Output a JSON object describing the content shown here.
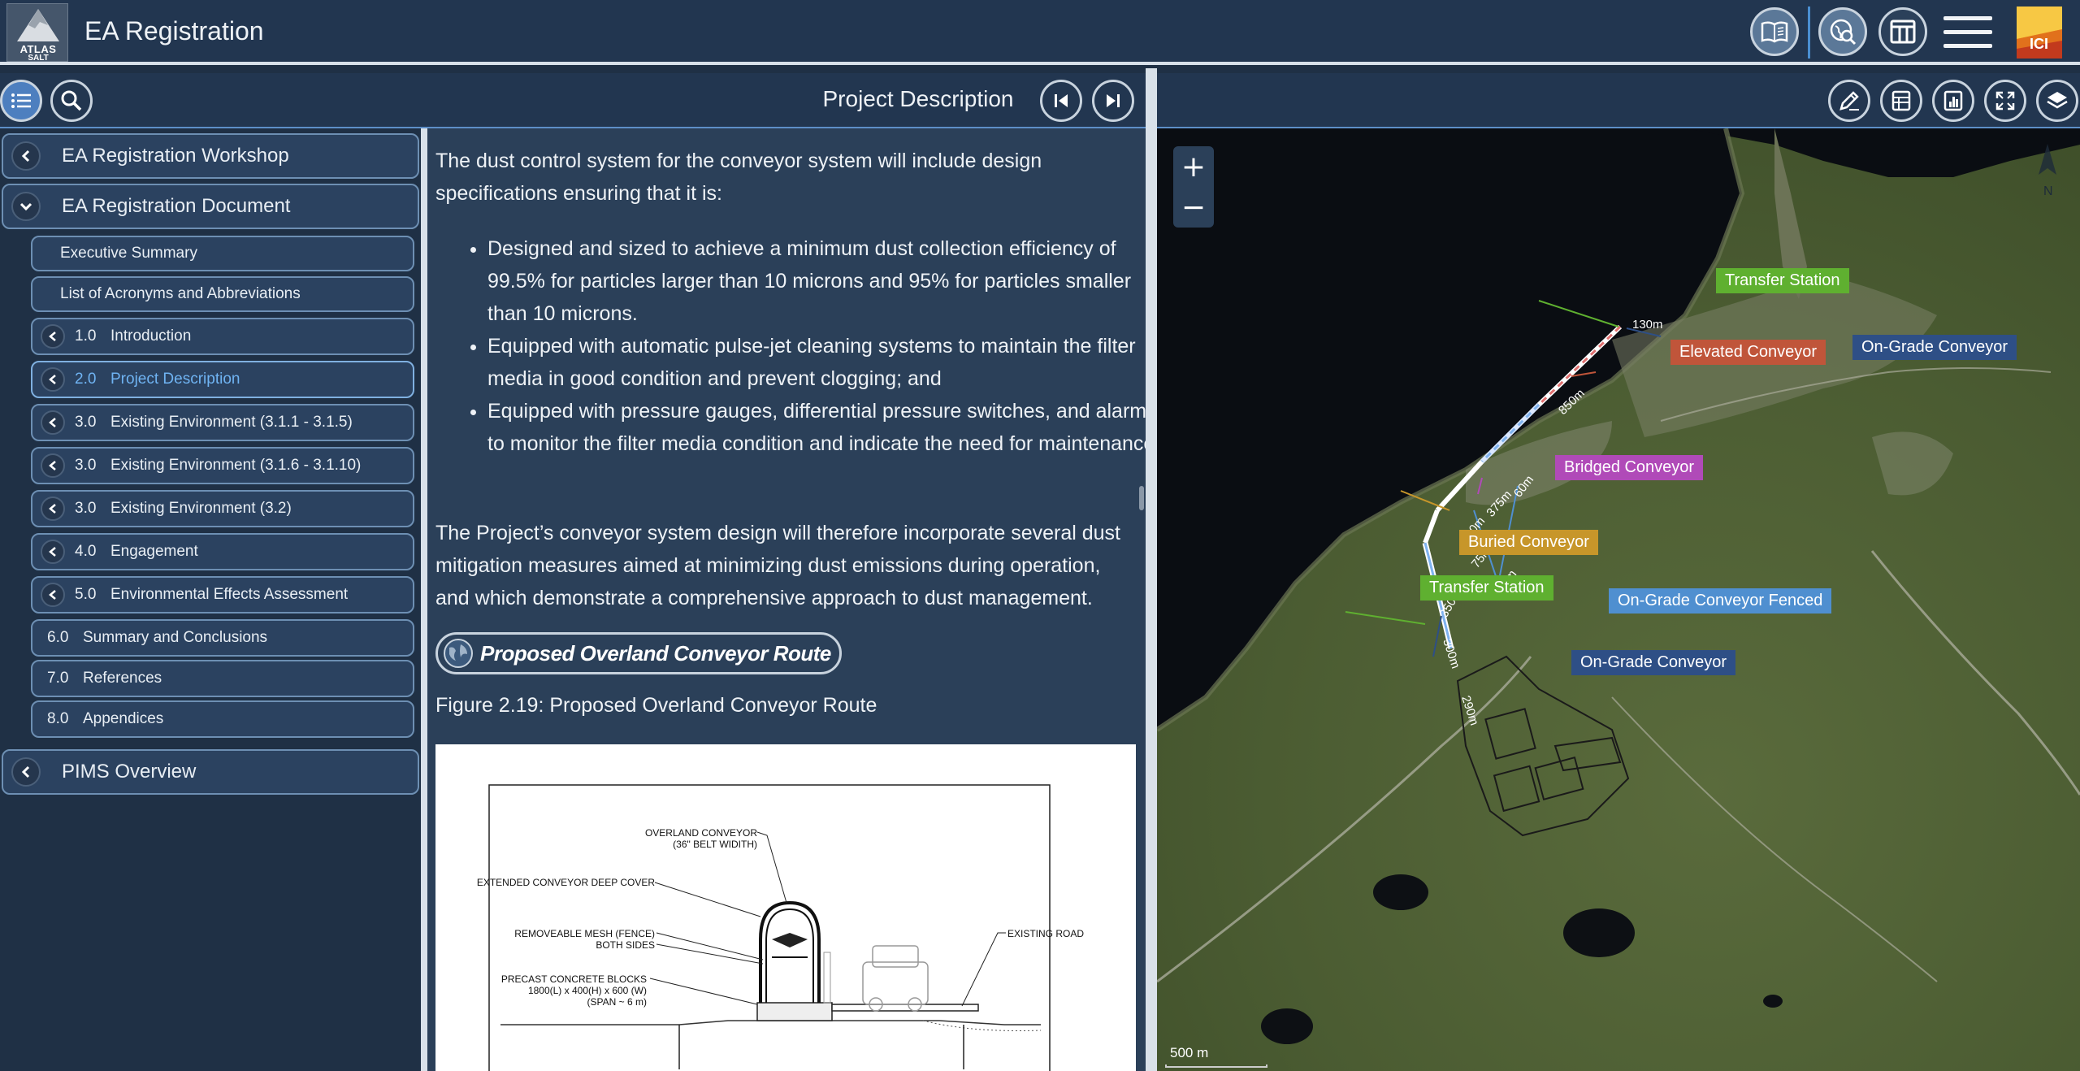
{
  "header": {
    "logo_text": "ATLAS",
    "logo_subtext": "SALT",
    "app_title": "EA Registration",
    "ici_text": "ICI",
    "buttons": [
      "book-icon",
      "globe-search-icon",
      "table-layout-icon",
      "hamburger-menu-icon"
    ]
  },
  "left_toolbar": {
    "title": "Project Description"
  },
  "sidebar": {
    "top_items": [
      {
        "label": "EA Registration Workshop"
      },
      {
        "label": "EA Registration Document"
      },
      {
        "label": "PIMS Overview"
      }
    ],
    "sub_items": [
      {
        "label": "Executive Summary"
      },
      {
        "label": "List of Acronyms and Abbreviations"
      }
    ],
    "sections": [
      {
        "num": "1.0",
        "label": "Introduction"
      },
      {
        "num": "2.0",
        "label": "Project Description"
      },
      {
        "num": "3.0",
        "label": "Existing Environment (3.1.1 - 3.1.5)"
      },
      {
        "num": "3.0",
        "label": "Existing Environment (3.1.6 - 3.1.10)"
      },
      {
        "num": "3.0",
        "label": "Existing Environment (3.2)"
      },
      {
        "num": "4.0",
        "label": "Engagement"
      },
      {
        "num": "5.0",
        "label": "Environmental Effects Assessment"
      },
      {
        "num": "6.0",
        "label": "Summary and Conclusions"
      },
      {
        "num": "7.0",
        "label": "References"
      },
      {
        "num": "8.0",
        "label": "Appendices"
      }
    ]
  },
  "content": {
    "intro": "The dust control system for the conveyor system will include design specifications ensuring that it is:",
    "bullets": [
      "Designed and sized to achieve a minimum dust collection efficiency of 99.5% for particles larger than 10 microns and 95% for particles smaller than 10 microns.",
      "Equipped with automatic pulse-jet cleaning systems to maintain the filter media in good condition and prevent clogging; and",
      "Equipped with pressure gauges, differential pressure switches, and alarms to monitor the filter media condition and indicate the need for maintenance."
    ],
    "summary": "The Project’s conveyor system design will therefore incorporate several dust mitigation measures aimed at minimizing dust emissions during operation, and which demonstrate a comprehensive approach to dust management.",
    "route_button": "Proposed Overland Conveyor Route",
    "figure_caption": "Figure 2.19: Proposed Overland Conveyor Route",
    "figure_labels": {
      "overland": "OVERLAND CONVEYOR",
      "belt": "(36\" BELT WIDITH)",
      "deep_cover": "EXTENDED CONVEYOR DEEP COVER",
      "mesh": "REMOVEABLE MESH (FENCE)",
      "both_sides": "BOTH SIDES",
      "blocks": "PRECAST CONCRETE BLOCKS",
      "dims": "1800(L) x 400(H) x 600 (W)",
      "span": "(SPAN ~ 6 m)",
      "road": "EXISTING ROAD"
    }
  },
  "map": {
    "zoom_in": "+",
    "zoom_out": "−",
    "scale_label": "500 m",
    "north_label": "N",
    "labels": [
      {
        "text": "Transfer Station",
        "color": "#5fb030"
      },
      {
        "text": "Elevated Conveyor",
        "color": "#c0553a"
      },
      {
        "text": "On-Grade Conveyor",
        "color": "#2e4f86"
      },
      {
        "text": "Bridged Conveyor",
        "color": "#b04ab8"
      },
      {
        "text": "Buried Conveyor",
        "color": "#c7962a"
      },
      {
        "text": "Transfer Station",
        "color": "#5fb030"
      },
      {
        "text": "On-Grade Conveyor Fenced",
        "color": "#4f8fd0"
      },
      {
        "text": "On-Grade Conveyor",
        "color": "#2e4f86"
      }
    ],
    "distances": [
      "130m",
      "850m",
      "60m",
      "375m",
      "100m",
      "75m",
      "100m",
      "350m",
      "300m",
      "290m"
    ]
  }
}
